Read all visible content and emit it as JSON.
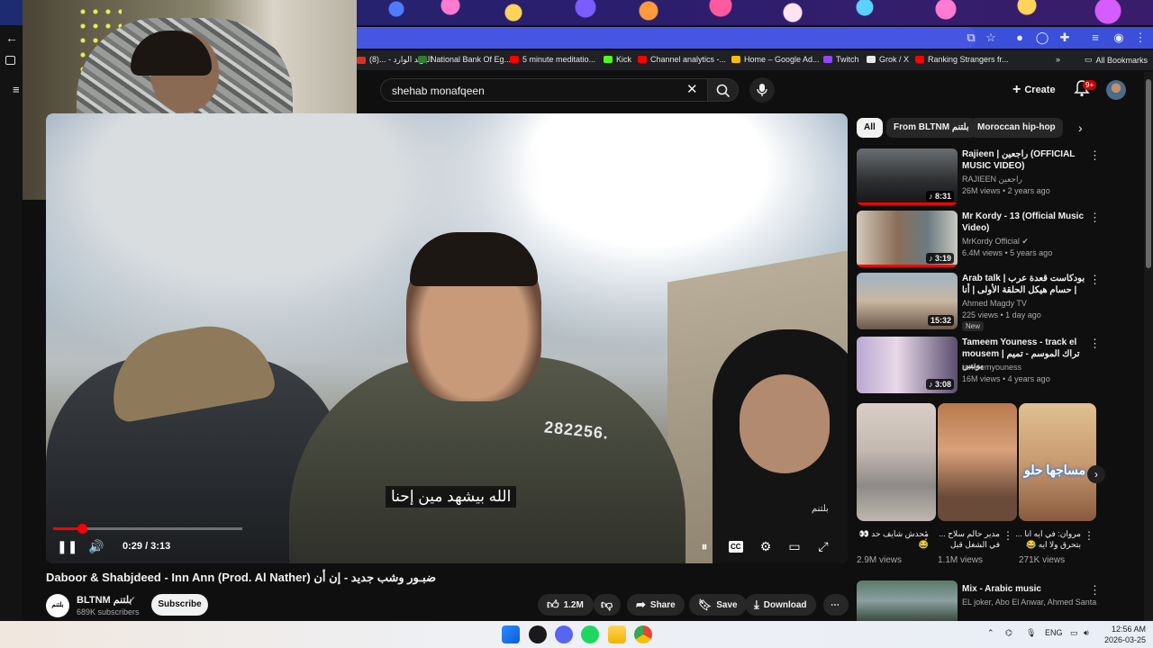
{
  "browser": {
    "bookmarks": [
      {
        "label": "البريد الوارد - ...(8)",
        "color": "#d93025"
      },
      {
        "label": "National Bank Of Eg...",
        "color": "#2e7d32"
      },
      {
        "label": "5 minute meditatio...",
        "color": "#ff0000"
      },
      {
        "label": "Kick",
        "color": "#53fc18"
      },
      {
        "label": "Channel analytics -...",
        "color": "#ff0000"
      },
      {
        "label": "Home – Google Ad...",
        "color": "#fbbc04"
      },
      {
        "label": "Twitch",
        "color": "#9146ff"
      },
      {
        "label": "Grok / X",
        "color": "#e8e8e8"
      },
      {
        "label": "Ranking Strangers fr...",
        "color": "#ff0000"
      }
    ],
    "all_bookmarks": "All Bookmarks"
  },
  "header": {
    "search_value": "shehab monafqeen",
    "create_label": "Create",
    "notif_badge": "9+"
  },
  "player": {
    "subtitle": "الله بيشهد مين إحنا",
    "jersey_text": "282256.",
    "watermark": "بلتنم",
    "time": "0:29 / 3:13",
    "progress_fraction": 0.152
  },
  "video": {
    "title": "Daboor & Shabjdeed - Inn Ann (Prod. Al Nather) ضبـور وشب جديد - إن أن",
    "channel_name": "BLTNM",
    "channel_avatar_text": "بلتنم",
    "channel_suffix": "بلتنم",
    "subscribers": "689K subscribers",
    "subscribe_label": "Subscribe",
    "likes": "1.2M",
    "share_label": "Share",
    "save_label": "Save",
    "download_label": "Download"
  },
  "sidebar": {
    "chips": [
      "All",
      "From BLTNM بلتنم",
      "Moroccan hip-hop"
    ],
    "recommendations": [
      {
        "title": "Rajieen | راجعين (OFFICIAL MUSIC VIDEO)",
        "channel": "RAJIEEN راجعين",
        "meta": "26M views • 2 years ago",
        "duration": "♪ 8:31",
        "badge": ""
      },
      {
        "title": "Mr Kordy - 13 (Official Music Video)",
        "channel": "MrKordy Official ✔",
        "meta": "6.4M views • 5 years ago",
        "duration": "♪ 3:19",
        "badge": ""
      },
      {
        "title": "Arab talk | بودكاست قعدة عرب | حسام هيكل   الحلقة الأولى | أنا podcas...",
        "channel": "Ahmed Magdy TV",
        "meta": "225 views • 1 day ago",
        "duration": "15:32",
        "badge": "New"
      },
      {
        "title": "Tameem Youness - track el mousem | تراك الموسم - تميم يونس",
        "channel": "tameemyouness",
        "meta": "16M views • 4 years ago",
        "duration": "♪ 3:08",
        "badge": ""
      }
    ],
    "shorts": [
      {
        "title": "محدش شايف حد 👀😂",
        "views": "2.9M views"
      },
      {
        "title": "مدير حالم سلاح ... في الشغل قبل",
        "views": "1.1M views"
      },
      {
        "title": "مروان: في ايه انا ... بتحرق ولا ايه 😂",
        "views": "271K views"
      }
    ],
    "shorts_overlay": "مساجها حلو",
    "mix": {
      "title": "Mix - Arabic music",
      "channel": "EL joker, Abo El Anwar, Ahmed Santa, an..."
    }
  },
  "taskbar": {
    "lang": "ENG",
    "time": "12:56 AM",
    "date": "2026-03-25"
  },
  "colors": {
    "accent": "#ff0000",
    "background": "#0f0f0f",
    "chip": "#272727"
  }
}
